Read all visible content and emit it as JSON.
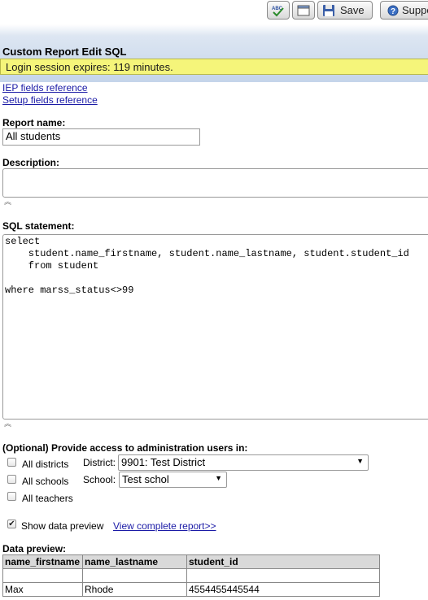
{
  "toolbar": {
    "spellcheck_icon": "spellcheck-icon",
    "window_icon": "window-icon",
    "save_label": "Save",
    "support_label": "Suppo"
  },
  "page": {
    "title": "Custom Report Edit SQL",
    "session_message": "Login session expires: 119 minutes."
  },
  "links": {
    "iep_fields": "IEP fields reference",
    "setup_fields": "Setup fields reference"
  },
  "form": {
    "report_name_label": "Report name:",
    "report_name_value": "All students",
    "description_label": "Description:",
    "description_value": "",
    "sql_label": "SQL statement:",
    "sql_value": "select\n    student.name_firstname, student.name_lastname, student.student_id\n    from student\n\nwhere marss_status<>99"
  },
  "access": {
    "heading": "(Optional) Provide access to administration users in:",
    "all_districts": "All districts",
    "all_schools": "All schools",
    "all_teachers": "All teachers",
    "district_label": "District:",
    "district_value": "9901: Test District",
    "school_label": "School:",
    "school_value": "Test schol"
  },
  "preview": {
    "show_label": "Show data preview",
    "show_checked": true,
    "view_link": "View complete report>>",
    "heading": "Data preview:",
    "columns": [
      "name_firstname",
      "name_lastname",
      "student_id"
    ],
    "rows": [
      [
        "",
        "",
        ""
      ],
      [
        "Max",
        "Rhode",
        "4554455445544"
      ]
    ]
  },
  "colors": {
    "session_bar": "#f5f57a",
    "link": "#1a1aa6",
    "header_band": "#c5d5ea"
  }
}
